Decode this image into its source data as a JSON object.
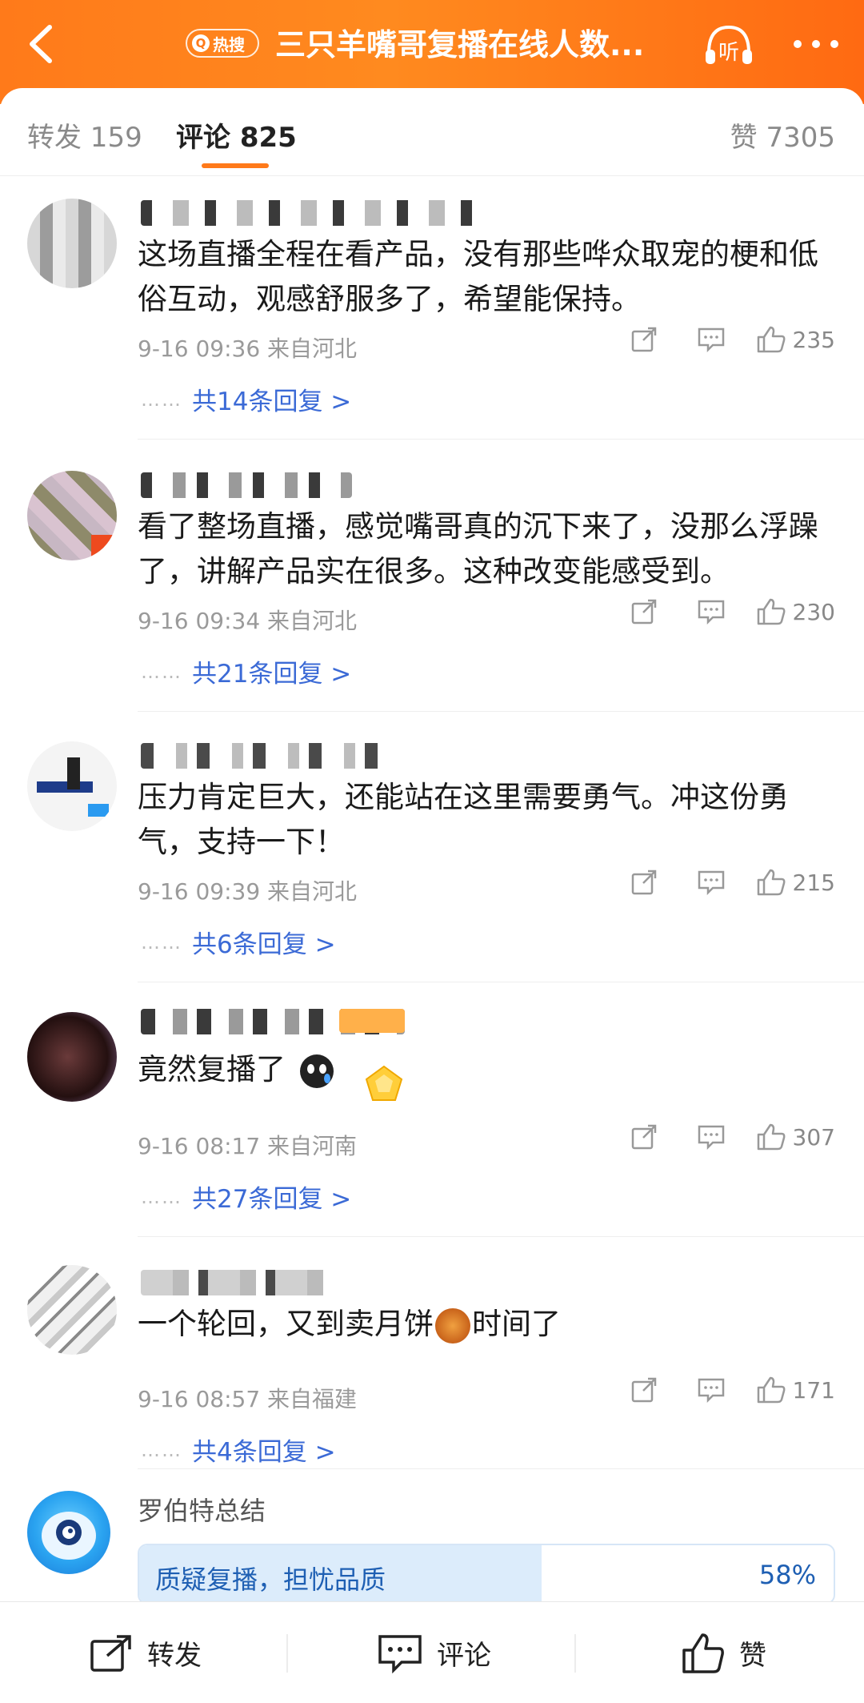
{
  "header": {
    "hot_tag": "热搜",
    "hot_tag_q": "Q",
    "title": "三只羊嘴哥复播在线人数...",
    "listen_label": "听",
    "bg_color": "#ff7a1a"
  },
  "tabs": [
    {
      "label": "转发 159"
    },
    {
      "label": "评论 825"
    },
    {
      "label": "赞 7305"
    }
  ],
  "comments": [
    {
      "text": "这场直播全程在看产品，没有那些哗众取宠的梗和低俗互动，观感舒服多了，希望能保持。",
      "meta": "9-16 09:36  来自河北",
      "likes": "235",
      "replies": "共14条回复 >"
    },
    {
      "text": "看了整场直播，感觉嘴哥真的沉下来了，没那么浮躁了，讲解产品实在很多。这种改变能感受到。",
      "meta": "9-16 09:34  来自河北",
      "likes": "230",
      "replies": "共21条回复 >"
    },
    {
      "text": "压力肯定巨大，还能站在这里需要勇气。冲这份勇气，支持一下！",
      "meta": "9-16 09:39  来自河北",
      "likes": "215",
      "replies": "共6条回复 >"
    },
    {
      "text": "竟然复播了",
      "meta": "9-16 08:17  来自河南",
      "likes": "307",
      "replies": "共27条回复 >"
    },
    {
      "text_before": "一个轮回，又到卖月饼",
      "text_after": "时间了",
      "meta": "9-16 08:57  来自福建",
      "likes": "171",
      "replies": "共4条回复 >"
    }
  ],
  "replies_dots": "……",
  "summary": {
    "title": "罗伯特总结",
    "poll_label": "质疑复播，担忧品质",
    "poll_pct": "58%",
    "poll_fraction": 0.58
  },
  "bottom_bar": {
    "repost": "转发",
    "comment": "评论",
    "like": "赞"
  }
}
